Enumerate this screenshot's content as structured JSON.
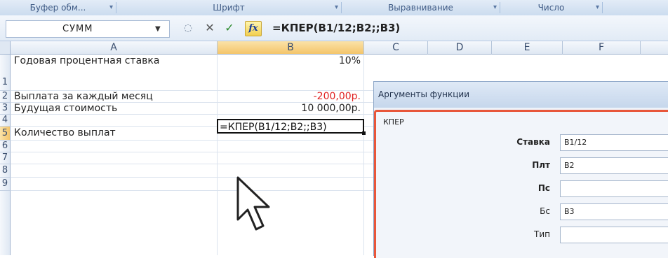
{
  "ribbon": {
    "groups": [
      {
        "label": "Буфер обм..."
      },
      {
        "label": "Шрифт"
      },
      {
        "label": "Выравнивание"
      },
      {
        "label": "Число"
      }
    ]
  },
  "formula_bar": {
    "name_box": "СУММ",
    "cancel_glyph": "✕",
    "enter_glyph": "✓",
    "fx_label": "fx",
    "formula": "=КПЕР(B1/12;B2;;B3)"
  },
  "sheet": {
    "columns": [
      "A",
      "B",
      "C",
      "D",
      "E",
      "F"
    ],
    "rows": [
      "1",
      "2",
      "3",
      "4",
      "5",
      "6",
      "7",
      "8",
      "9"
    ],
    "cells": {
      "A1": "Годовая процентная ставка",
      "B1": "10%",
      "A2": "Выплата за каждый месяц",
      "B2": "-200,00р.",
      "A3": "Будущая стоимость",
      "B3": "10 000,00р.",
      "A5": "Количество выплат",
      "B5": "=КПЕР(B1/12;B2;;B3)"
    }
  },
  "dialog": {
    "title": "Аргументы функции",
    "function_name": "КПЕР",
    "arguments": [
      {
        "label": "Ставка",
        "value": "B1/12"
      },
      {
        "label": "Плт",
        "value": "B2"
      },
      {
        "label": "Пс",
        "value": ""
      },
      {
        "label": "Бс",
        "value": "B3"
      },
      {
        "label": "Тип",
        "value": ""
      }
    ]
  },
  "colors": {
    "accent_red": "#e8563a",
    "negative": "#e02020",
    "header_selected": "#f4c56a"
  }
}
